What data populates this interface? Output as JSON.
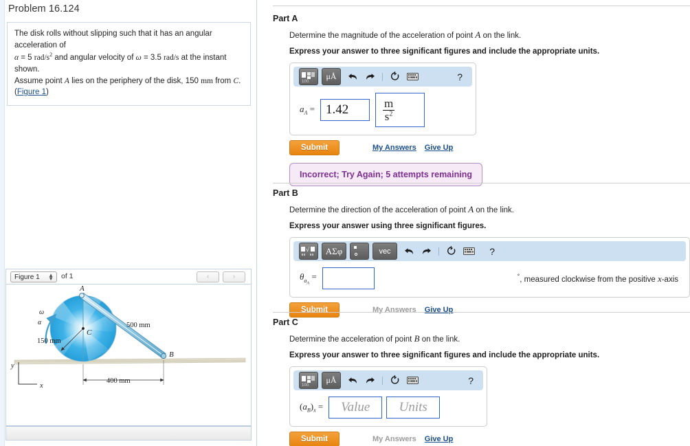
{
  "problem": {
    "title": "Problem 16.124",
    "statement_line1": "The disk rolls without slipping such that it has an angular acceleration of",
    "alpha_sym": "α",
    "alpha_val": "= 5",
    "alpha_units": "rad/s",
    "alpha_exp": "2",
    "mid_text": "and angular velocity of",
    "omega_sym": "ω",
    "omega_val": "= 3.5",
    "omega_units": "rad/s",
    "tail_text": "at the instant shown.",
    "statement_line3a": "Assume point",
    "point_a": "A",
    "statement_line3b": "lies on the periphery of the disk, 150",
    "mm_unit": "mm",
    "statement_line3c": "from",
    "point_c": "C",
    "statement_line3d": ".",
    "figure_link": "Figure 1",
    "paren_open": "(",
    "paren_close": ")"
  },
  "figure_panel": {
    "select_value": "Figure 1",
    "of_text": "of 1",
    "prev_icon": "‹",
    "next_icon": "›",
    "spinner_icon": "⬍"
  },
  "figure": {
    "label_A": "A",
    "label_B": "B",
    "label_C": "C",
    "label_omega": "ω",
    "label_alpha": "α",
    "dim_radius": "150 mm",
    "dim_link": "500 mm",
    "dim_base": "400 mm",
    "axis_y": "y",
    "axis_x": "x",
    "disk_color": "#29a8e0",
    "ground_color": "#d8d4c0",
    "link_color": "#8fc6e0"
  },
  "toolbar": {
    "undo_icon": "↶",
    "redo_icon": "↷",
    "reset_icon": "↻",
    "keyboard_icon": "⌨",
    "help_icon": "?",
    "template_label": "□□",
    "template_sub": "100.",
    "units_label": "μÅ",
    "sqrt_label": "□√□",
    "greek_label": "ΑΣφ",
    "exp_label": "□",
    "vec_label": "vec"
  },
  "partA": {
    "title": "Part A",
    "question_pre": "Determine the magnitude of the acceleration of point",
    "question_var": "A",
    "question_post": "on the link.",
    "instruction": "Express your answer to three significant figures and include the appropriate units.",
    "label": "a",
    "label_sub": "A",
    "label_eq": "=",
    "value": "1.42",
    "unit_num": "m",
    "unit_den": "s",
    "unit_den_exp": "2",
    "submit": "Submit",
    "my_answers": "My Answers",
    "give_up": "Give Up",
    "feedback": "Incorrect; Try Again; 5 attempts remaining"
  },
  "partB": {
    "title": "Part B",
    "question_pre": "Determine the direction of the acceleration of point",
    "question_var": "A",
    "question_post": "on the link.",
    "instruction": "Express your answer using three significant figures.",
    "label": "θ",
    "label_sub": "a",
    "label_sub2": "A",
    "label_eq": "=",
    "value": "",
    "suffix_deg": "°",
    "suffix_text": ", measured clockwise from the positive",
    "suffix_var": "x",
    "suffix_tail": "-axis",
    "submit": "Submit",
    "my_answers": "My Answers",
    "give_up": "Give Up"
  },
  "partC": {
    "title": "Part C",
    "question_pre": "Determine the acceleration of point",
    "question_var": "B",
    "question_post": "on the link.",
    "instruction": "Express your answer to three significant figures and include the appropriate units.",
    "label_open": "(",
    "label": "a",
    "label_sub": "B",
    "label_close": ")",
    "label_sub2": "x",
    "label_eq": "=",
    "value_placeholder": "Value",
    "units_placeholder": "Units",
    "submit": "Submit",
    "my_answers": "My Answers",
    "give_up": "Give Up"
  }
}
